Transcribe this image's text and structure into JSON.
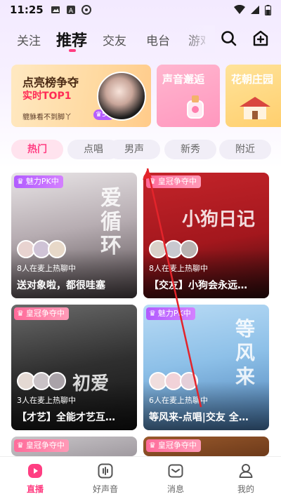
{
  "status_bar": {
    "time": "11:25"
  },
  "nav": {
    "tabs": [
      {
        "label": "关注",
        "active": false
      },
      {
        "label": "推荐",
        "active": true
      },
      {
        "label": "交友",
        "active": false
      },
      {
        "label": "电台",
        "active": false
      },
      {
        "label": "游戏",
        "active": false
      }
    ],
    "search_icon": "search-icon",
    "create_room_icon": "add-room-icon"
  },
  "banners": {
    "main": {
      "title": "点亮榜争夺",
      "subtitle": "实时TOP1",
      "user": "貔貅看不到脚丫",
      "badge": "54"
    },
    "cards": [
      {
        "title": "声音邂逅"
      },
      {
        "title": "花朝庄园"
      }
    ]
  },
  "filters": [
    {
      "label": "热门",
      "active": true
    },
    {
      "label": "点唱",
      "active": false
    },
    {
      "label": "男声",
      "active": false
    },
    {
      "label": "新秀",
      "active": false
    },
    {
      "label": "附近",
      "active": false
    }
  ],
  "rooms": [
    {
      "badge": "魅力PK中",
      "badge_type": "pk",
      "count": "8人在麦上热聊中",
      "title": "送对象啦，都很哇塞",
      "art": "爱循环"
    },
    {
      "badge": "皇冠争夺中",
      "badge_type": "crown",
      "count": "8人在麦上热聊中",
      "title": "【交友】小狗会永远…",
      "art": "小狗日记"
    },
    {
      "badge": "皇冠争夺中",
      "badge_type": "crown",
      "count": "3人在麦上热聊中",
      "title": "【才艺】全能才艺互…",
      "art": "初爱"
    },
    {
      "badge": "魅力PK中",
      "badge_type": "pk",
      "count": "6人在麦上热聊中",
      "title": "等风来-点唱|交友 全…",
      "art": "等风来"
    },
    {
      "badge": "皇冠争夺中",
      "badge_type": "crown"
    },
    {
      "badge": "皇冠争夺中",
      "badge_type": "crown"
    }
  ],
  "tabbar": [
    {
      "label": "直播",
      "active": true,
      "icon": "live-play-icon"
    },
    {
      "label": "好声音",
      "active": false,
      "icon": "voice-wave-icon"
    },
    {
      "label": "消息",
      "active": false,
      "icon": "message-icon"
    },
    {
      "label": "我的",
      "active": false,
      "icon": "profile-icon"
    }
  ],
  "colors": {
    "accent": "#ff3e82",
    "pk_badge": "#b15bff",
    "crown_badge": "#ff6b9a",
    "annotation_arrow": "#e3242b"
  }
}
